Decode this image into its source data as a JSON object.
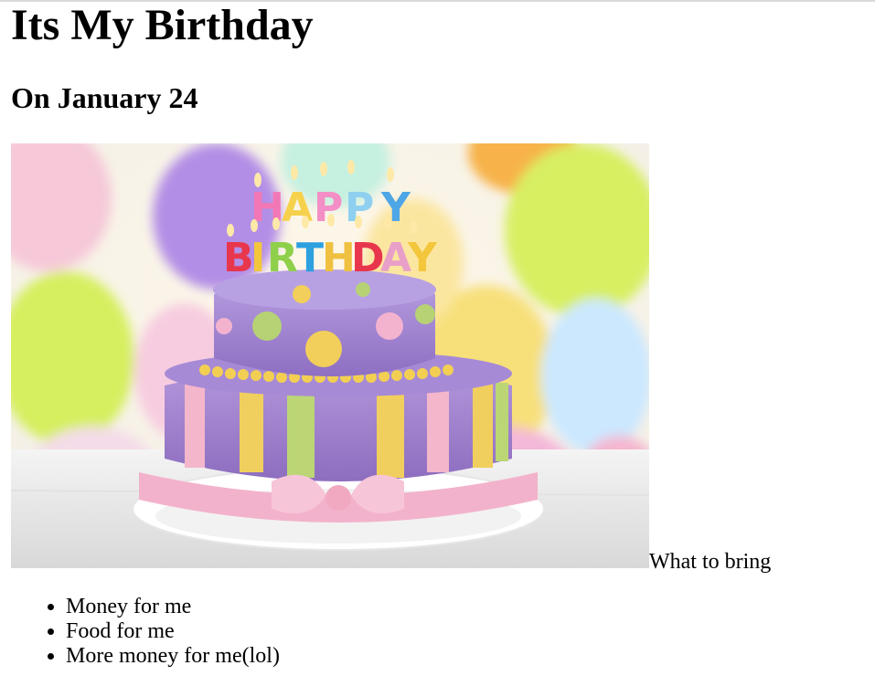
{
  "page": {
    "title": "Its My Birthday",
    "subtitle": "On January 24"
  },
  "image": {
    "description_icon": "birthday-cake-photo",
    "colors": {
      "background_balloons": [
        "#c9b3e8",
        "#d8f06a",
        "#f7e37a",
        "#f6b7cf",
        "#9fe0d2"
      ],
      "cake_purple": "#a98ad2",
      "cake_pink": "#f4b3cc",
      "cake_yellow": "#f0cf5a",
      "cake_green": "#b7d37a",
      "table": "#ececec"
    },
    "cake_text_top": "HAPPY",
    "cake_text_bottom": "BIRTHDAY"
  },
  "bring_label": "What to bring",
  "bring_items": [
    "Money for me",
    "Food for me",
    "More money for me(lol)"
  ]
}
